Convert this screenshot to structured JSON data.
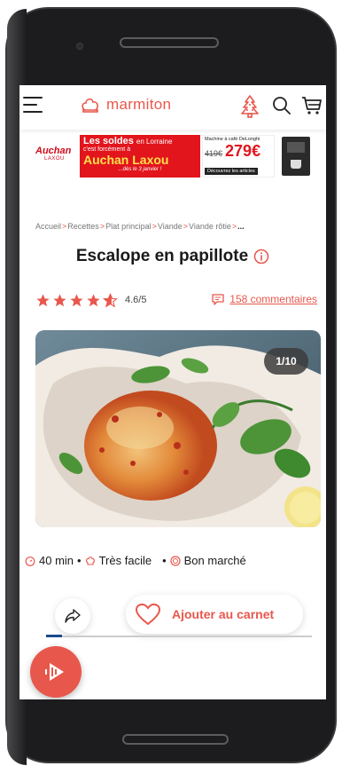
{
  "colors": {
    "brand": "#e8574c",
    "star": "#e8574c",
    "text": "#1a1a1a",
    "ad_red": "#e2151d"
  },
  "header": {
    "menu_icon": "hamburger-icon",
    "logo_text": "marmiton",
    "tree_icon": "christmas-tree-icon",
    "search_icon": "search-icon",
    "cart_icon": "cart-icon"
  },
  "ad": {
    "brand_top": "Auchan",
    "brand_bottom": "LAXOU",
    "headline": "Les soldes",
    "headline_suffix": "en Lorraine",
    "subline": "c'est forcément à",
    "store": "Auchan Laxou",
    "date": "...dès le 3 janvier !",
    "promo_title": "Machine à café DeLonghi",
    "old_price": "419€",
    "new_price": "279€",
    "cta": "Découvrez les articles"
  },
  "breadcrumb": [
    "Accueil",
    "Recettes",
    "Plat principal",
    "Viande",
    "Viande rôtie",
    "..."
  ],
  "recipe": {
    "title": "Escalope en papillote",
    "rating": 4.6,
    "rating_text": "4.6/5",
    "comments_text": "158 commentaires",
    "photo_counter": "1/10",
    "time": "40 min",
    "difficulty": "Très facile",
    "cost": "Bon marché"
  },
  "actions": {
    "share_icon": "share-icon",
    "carnet_label": "Ajouter au carnet",
    "heart_icon": "heart-icon",
    "fab_icon": "play-icon"
  }
}
